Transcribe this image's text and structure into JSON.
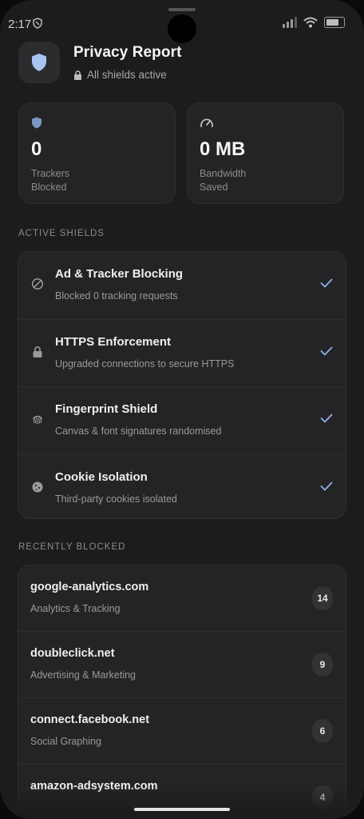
{
  "status_bar": {
    "time": "2:17"
  },
  "header": {
    "title": "Privacy Report",
    "subtitle": "All shields active"
  },
  "stats": [
    {
      "value": "0",
      "label": "Trackers\nBlocked",
      "icon": "shield-icon"
    },
    {
      "value": "0 MB",
      "label": "Bandwidth\nSaved",
      "icon": "gauge-icon"
    }
  ],
  "active_shields": {
    "label": "ACTIVE SHIELDS",
    "items": [
      {
        "name": "Ad & Tracker Blocking",
        "desc": "Blocked 0 tracking requests",
        "icon": "block-icon"
      },
      {
        "name": "HTTPS Enforcement",
        "desc": "Upgraded connections to secure HTTPS",
        "icon": "lock-icon"
      },
      {
        "name": "Fingerprint Shield",
        "desc": "Canvas & font signatures randomised",
        "icon": "fingerprint-icon"
      },
      {
        "name": "Cookie Isolation",
        "desc": "Third-party cookies isolated",
        "icon": "cookie-icon"
      }
    ]
  },
  "recently_blocked": {
    "label": "RECENTLY BLOCKED",
    "items": [
      {
        "domain": "google-analytics.com",
        "category": "Analytics & Tracking",
        "count": "14"
      },
      {
        "domain": "doubleclick.net",
        "category": "Advertising & Marketing",
        "count": "9"
      },
      {
        "domain": "connect.facebook.net",
        "category": "Social Graphing",
        "count": "6"
      },
      {
        "domain": "amazon-adsystem.com",
        "category": "",
        "count": "4"
      }
    ]
  },
  "colors": {
    "accent": "#8fb0e8",
    "background": "#1c1c1e",
    "card": "#242426"
  }
}
